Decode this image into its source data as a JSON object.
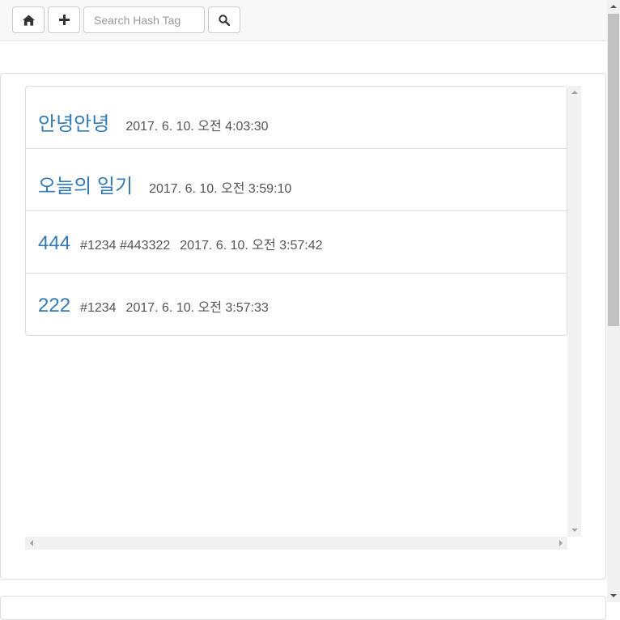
{
  "toolbar": {
    "home_icon": "home-icon",
    "add_icon": "plus-icon",
    "search_placeholder": "Search Hash Tag",
    "search_value": "",
    "search_icon": "search-icon"
  },
  "posts": [
    {
      "title": "안녕안녕",
      "tags": "",
      "date": "2017. 6. 10. 오전 4:03:30"
    },
    {
      "title": "오늘의 일기",
      "tags": "",
      "date": "2017. 6. 10. 오전 3:59:10"
    },
    {
      "title": "444",
      "tags": "#1234 #443322",
      "date": "2017. 6. 10. 오전 3:57:42"
    },
    {
      "title": "222",
      "tags": "#1234",
      "date": "2017. 6. 10. 오전 3:57:33"
    }
  ],
  "colors": {
    "link": "#337ab7",
    "muted_text": "#555555",
    "border": "#dddddd",
    "navbar_bg": "#f8f8f8"
  }
}
